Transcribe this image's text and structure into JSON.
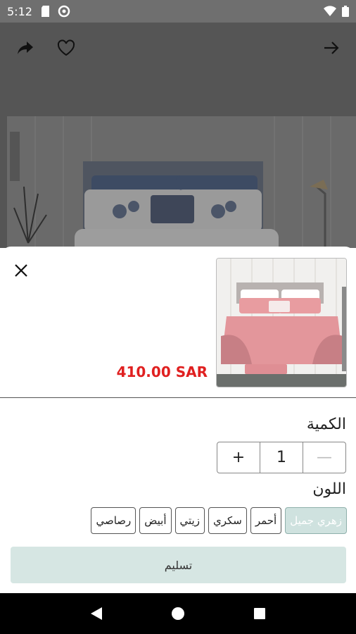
{
  "status_bar": {
    "time": "5:12",
    "icons": [
      "sd-card-icon",
      "data-saver-icon",
      "wifi-icon",
      "battery-icon"
    ]
  },
  "top_actions": {
    "share_icon": "share-icon",
    "favorite_icon": "heart-outline-icon",
    "back_icon": "arrow-forward-icon"
  },
  "sheet": {
    "close_icon": "close-icon",
    "price": "410.00 SAR",
    "quantity": {
      "label": "الكمية",
      "plus": "+",
      "value": "1",
      "minus": "—"
    },
    "color": {
      "label": "اللون",
      "options": [
        "زهري جميل",
        "أحمر",
        "سكري",
        "زيتي",
        "أبيض",
        "رصاصي"
      ],
      "selected": "زهري جميل"
    },
    "submit_label": "تسليم"
  },
  "colors": {
    "price": "#e02020",
    "selected_chip": "#cfe2df",
    "submit_button": "#d6e6e3"
  }
}
